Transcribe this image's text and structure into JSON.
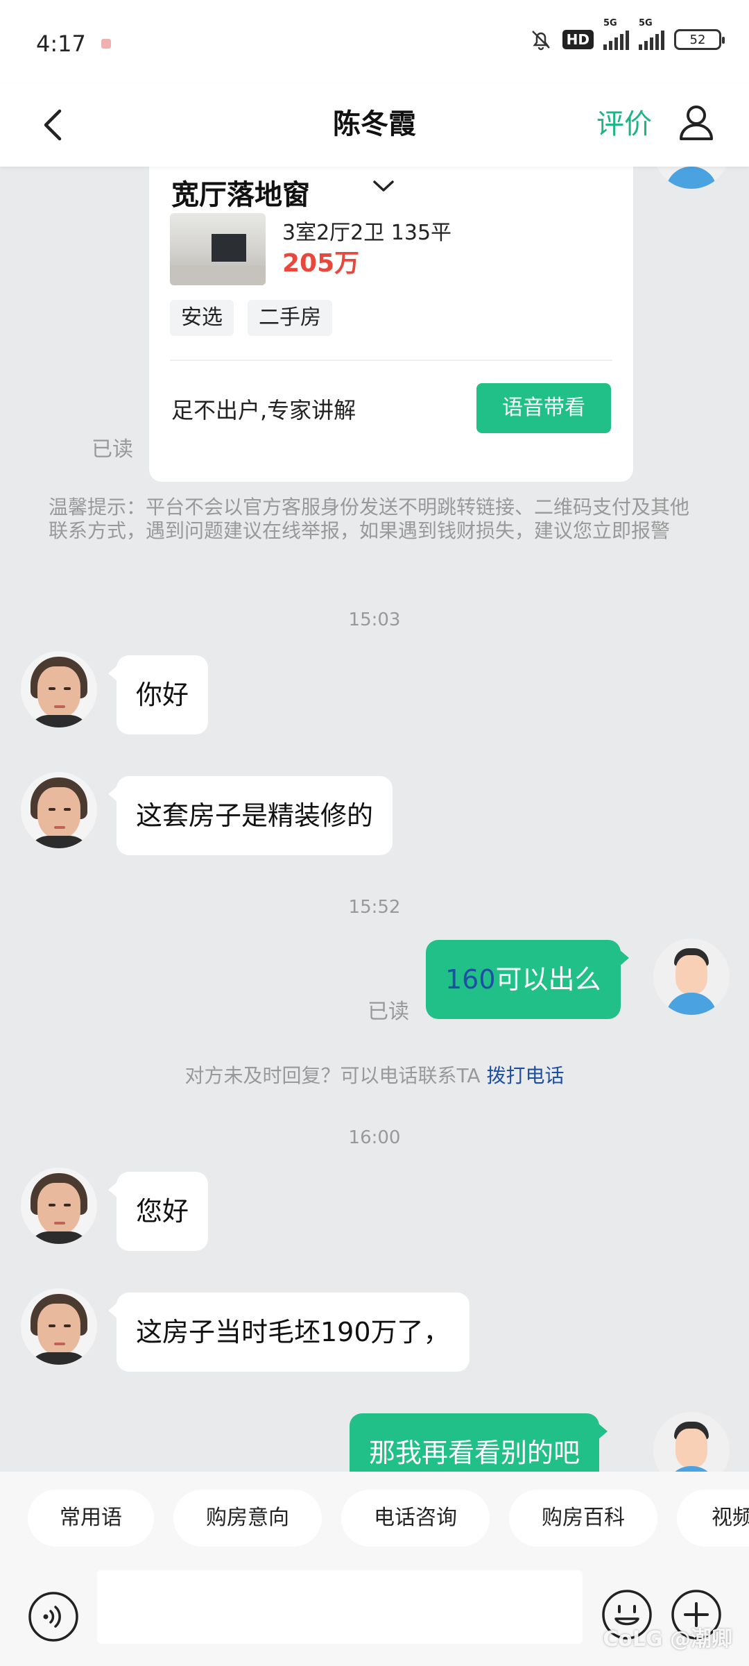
{
  "status_bar": {
    "time": "4:17",
    "hd_label": "HD",
    "network_label_1": "5G",
    "network_label_2": "5G",
    "battery": "52"
  },
  "header": {
    "title": "陈冬霞",
    "rate_label": "评价"
  },
  "listing_card": {
    "title": "宽厅落地窗",
    "spec": "3室2厅2卫 135平",
    "price": "205万",
    "tags": [
      "安选",
      "二手房"
    ],
    "expert_text": "足不出户,专家讲解",
    "voice_button": "语音带看"
  },
  "card_read": "已读",
  "tip": "温馨提示：平台不会以官方客服身份发送不明跳转链接、二维码支付及其他联系方式，遇到问题建议在线举报，如果遇到钱财损失，建议您立即报警",
  "messages": [
    {
      "time": "15:03"
    },
    {
      "text": "你好"
    },
    {
      "text": "这套房子是精装修的"
    },
    {
      "time": "15:52"
    },
    {
      "num": "160",
      "rest": "可以出么",
      "read": "已读"
    },
    {
      "notice": "对方未及时回复？可以电话联系TA",
      "link": "拨打电话"
    },
    {
      "time": "16:00"
    },
    {
      "text": "您好"
    },
    {
      "text": "这房子当时毛坯190万了，"
    },
    {
      "text": "那我再看看别的吧"
    }
  ],
  "quick_replies": [
    "常用语",
    "购房意向",
    "电话咨询",
    "购房百科",
    "视频"
  ],
  "input": {
    "placeholder": ""
  },
  "watermark": "CoLG @潮卿",
  "colors": {
    "accent": "#20c088",
    "price": "#e9473b",
    "link": "#1e4fa3"
  }
}
